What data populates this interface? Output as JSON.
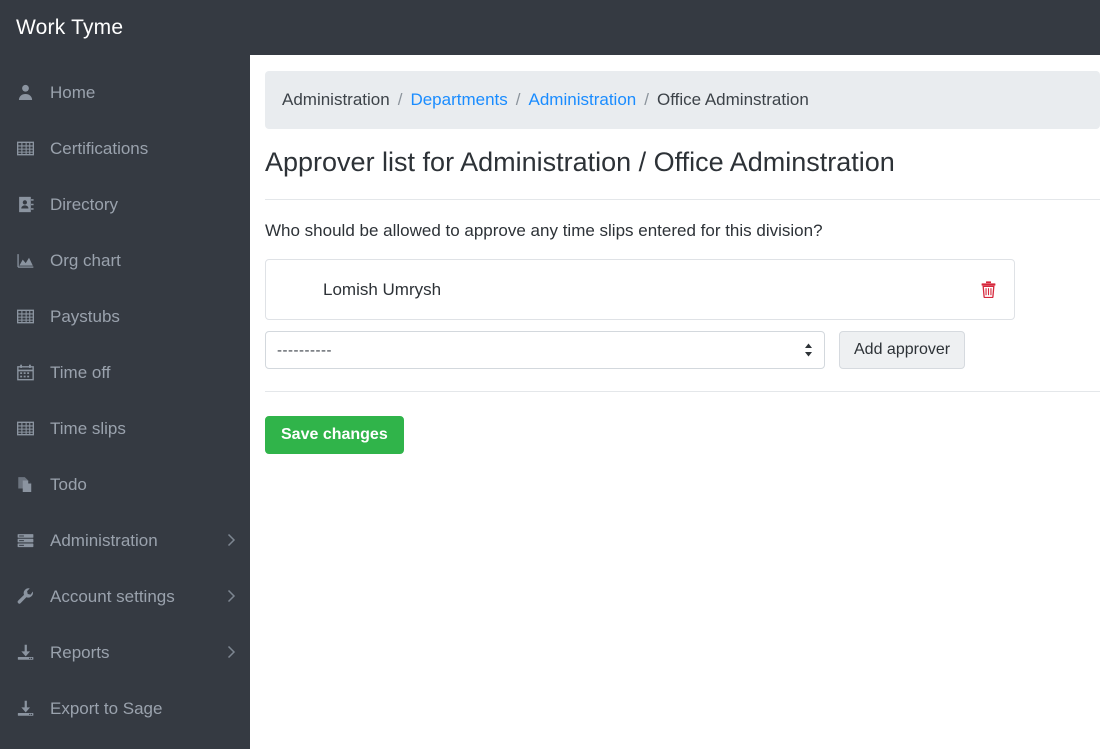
{
  "app": {
    "brand": "Work Tyme"
  },
  "sidebar": {
    "items": [
      {
        "label": "Home",
        "icon": "user-icon",
        "chevron": false
      },
      {
        "label": "Certifications",
        "icon": "table-icon",
        "chevron": false
      },
      {
        "label": "Directory",
        "icon": "address-book-icon",
        "chevron": false
      },
      {
        "label": "Org chart",
        "icon": "area-chart-icon",
        "chevron": false
      },
      {
        "label": "Paystubs",
        "icon": "table-icon",
        "chevron": false
      },
      {
        "label": "Time off",
        "icon": "calendar-icon",
        "chevron": false
      },
      {
        "label": "Time slips",
        "icon": "table-icon",
        "chevron": false
      },
      {
        "label": "Todo",
        "icon": "copy-files-icon",
        "chevron": false
      },
      {
        "label": "Administration",
        "icon": "server-list-icon",
        "chevron": true
      },
      {
        "label": "Account settings",
        "icon": "wrench-icon",
        "chevron": true
      },
      {
        "label": "Reports",
        "icon": "download-icon",
        "chevron": true
      },
      {
        "label": "Export to Sage",
        "icon": "download-icon",
        "chevron": false
      }
    ]
  },
  "breadcrumb": {
    "items": [
      {
        "label": "Administration",
        "link": false
      },
      {
        "label": "Departments",
        "link": true
      },
      {
        "label": "Administration",
        "link": true
      },
      {
        "label": "Office Adminstration",
        "link": false
      }
    ],
    "separator": "/"
  },
  "main": {
    "page_title": "Approver list for Administration / Office Adminstration",
    "prompt": "Who should be allowed to approve any time slips entered for this division?",
    "approvers": [
      {
        "name": "Lomish Umrysh",
        "delete_icon": "trash-icon"
      }
    ],
    "add_select": {
      "value": "----------",
      "indicator_icon": "select-arrows-icon"
    },
    "add_button_label": "Add approver",
    "save_button_label": "Save changes"
  },
  "colors": {
    "sidebar_bg": "#353a42",
    "breadcrumb_bg": "#e9ecef",
    "link_blue": "#1a8cff",
    "save_green": "#30b44a",
    "trash_red": "#d6273b"
  }
}
